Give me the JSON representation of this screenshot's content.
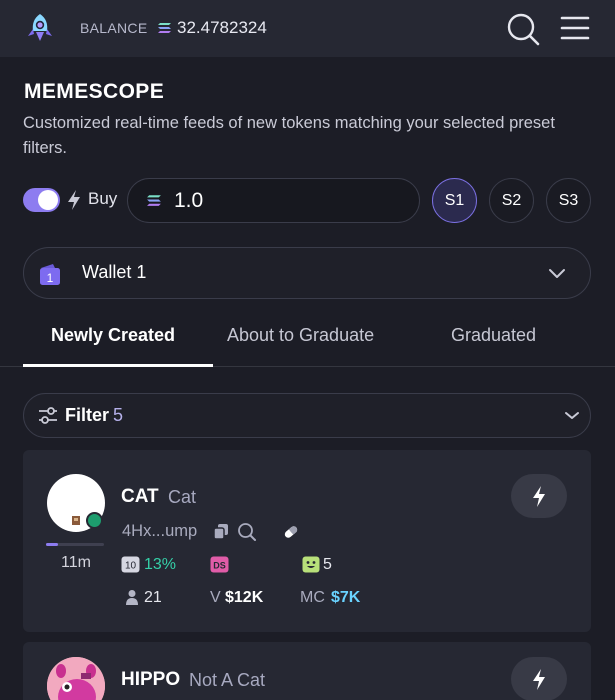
{
  "header": {
    "balance_label": "BALANCE",
    "balance_value": "32.4782324",
    "icons": [
      "rocket-logo-icon",
      "solana-icon",
      "search-icon",
      "menu-icon"
    ]
  },
  "memescope": {
    "title": "MEMESCOPE",
    "subtitle": "Customized real-time feeds of new tokens matching your selected preset filters."
  },
  "quick_buy": {
    "enabled": true,
    "buy_label": "Buy",
    "amount": "1.0",
    "presets": [
      "S1",
      "S2",
      "S3"
    ],
    "active_preset": "S1"
  },
  "wallet": {
    "badge": "1",
    "label": "Wallet 1"
  },
  "tabs": [
    {
      "label": "Newly Created",
      "active": true
    },
    {
      "label": "About to Graduate",
      "active": false
    },
    {
      "label": "Graduated",
      "active": false
    }
  ],
  "filter": {
    "label": "Filter",
    "count": "5"
  },
  "tokens": [
    {
      "symbol": "CAT",
      "name": "Cat",
      "address": "4Hx...ump",
      "age": "11m",
      "top10_badge": "10",
      "top10_pct": "13%",
      "dev_badge": "DS",
      "snipers": "5",
      "holders": "21",
      "volume_label": "V",
      "volume": "$12K",
      "mc_label": "MC",
      "mc": "$7K",
      "bonding_progress": 0.2
    },
    {
      "symbol": "HIPPO",
      "name": "Not A Cat"
    }
  ],
  "colors": {
    "accent": "#8d7cf0",
    "positive": "#35d0a8",
    "mc_value": "#6ad3ff",
    "dev_badge": "#e05ca8",
    "sniper_badge": "#b8e07a"
  }
}
